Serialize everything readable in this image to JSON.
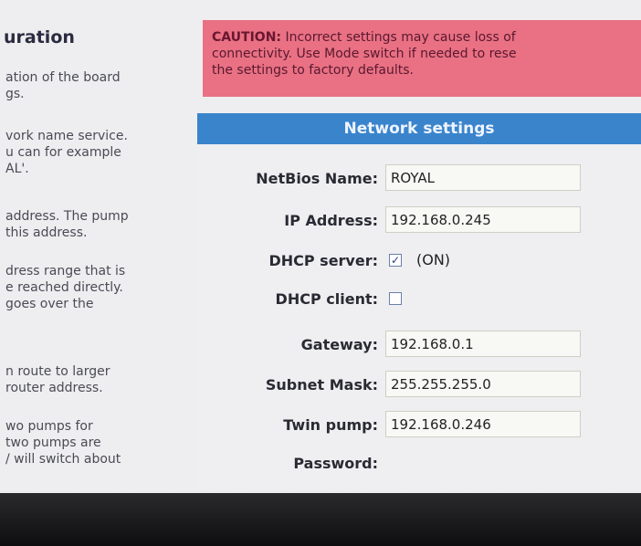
{
  "left": {
    "title": "uration",
    "paragraphs": [
      [
        "ation of the board",
        "gs."
      ],
      [
        "vork name service.",
        "u can for example",
        "AL'."
      ],
      [
        "address. The pump",
        "this address."
      ],
      [
        "dress range that is",
        "e reached directly.",
        "goes over the"
      ],
      [
        "n route to larger",
        "router address."
      ],
      [
        "wo pumps for",
        "two pumps are",
        "/ will switch about"
      ]
    ]
  },
  "caution": {
    "label": "CAUTION:",
    "line1": "Incorrect settings may cause loss of",
    "line2": "connectivity. Use Mode switch if needed to rese",
    "line3": "the settings to factory defaults."
  },
  "network": {
    "header": "Network settings",
    "netbios_label": "NetBios Name:",
    "netbios_value": "ROYAL",
    "ip_label": "IP Address:",
    "ip_value": "192.168.0.245",
    "dhcp_server_label": "DHCP server:",
    "dhcp_server_checked": true,
    "dhcp_server_state": "(ON)",
    "dhcp_client_label": "DHCP client:",
    "dhcp_client_checked": false,
    "gateway_label": "Gateway:",
    "gateway_value": "192.168.0.1",
    "subnet_label": "Subnet Mask:",
    "subnet_value": "255.255.255.0",
    "twin_label": "Twin pump:",
    "twin_value": "192.168.0.246",
    "password_label": "Password:",
    "password_value": ""
  },
  "colors": {
    "header_bg": "#3a84cc",
    "caution_bg": "#e97183"
  }
}
